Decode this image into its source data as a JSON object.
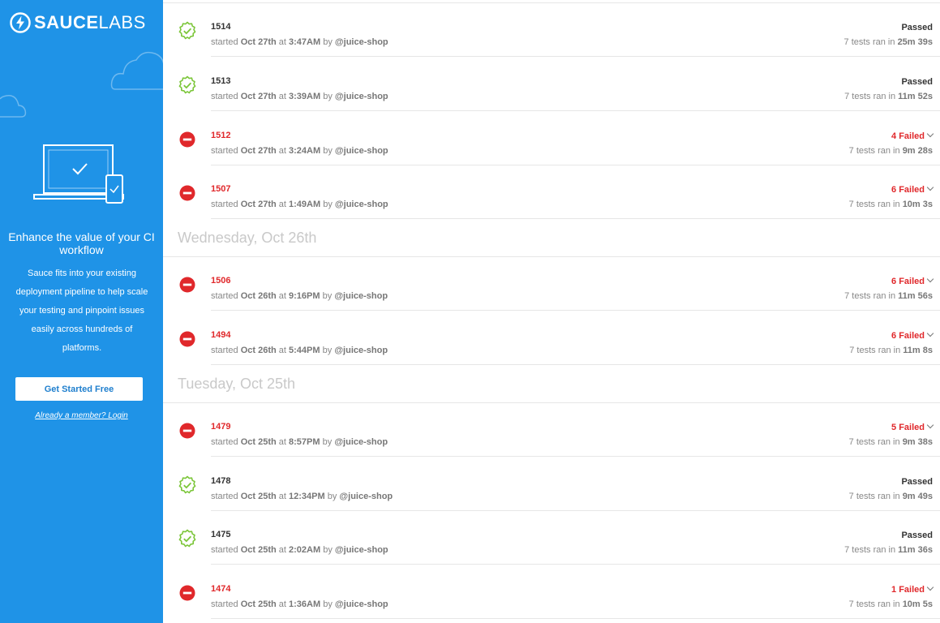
{
  "sidebar": {
    "logo_bold": "SAUCE",
    "logo_light": "LABS",
    "title": "Enhance the value of your CI workflow",
    "description": "Sauce fits into your existing deployment pipeline to help scale your testing and pinpoint issues easily across hundreds of platforms.",
    "cta_label": "Get Started Free",
    "login_label": "Already a member? Login"
  },
  "builds": [
    {
      "number": "1514",
      "status": "passed",
      "result": "Passed",
      "date": "Oct 27th",
      "time": "3:47AM",
      "user": "@juice-shop",
      "tests": "7",
      "duration": "25m 39s"
    },
    {
      "number": "1513",
      "status": "passed",
      "result": "Passed",
      "date": "Oct 27th",
      "time": "3:39AM",
      "user": "@juice-shop",
      "tests": "7",
      "duration": "11m 52s"
    },
    {
      "number": "1512",
      "status": "failed",
      "result": "4 Failed",
      "date": "Oct 27th",
      "time": "3:24AM",
      "user": "@juice-shop",
      "tests": "7",
      "duration": "9m 28s"
    },
    {
      "number": "1507",
      "status": "failed",
      "result": "6 Failed",
      "date": "Oct 27th",
      "time": "1:49AM",
      "user": "@juice-shop",
      "tests": "7",
      "duration": "10m 3s"
    },
    {
      "number": "1506",
      "status": "failed",
      "result": "6 Failed",
      "date": "Oct 26th",
      "time": "9:16PM",
      "user": "@juice-shop",
      "tests": "7",
      "duration": "11m 56s"
    },
    {
      "number": "1494",
      "status": "failed",
      "result": "6 Failed",
      "date": "Oct 26th",
      "time": "5:44PM",
      "user": "@juice-shop",
      "tests": "7",
      "duration": "11m 8s"
    },
    {
      "number": "1479",
      "status": "failed",
      "result": "5 Failed",
      "date": "Oct 25th",
      "time": "8:57PM",
      "user": "@juice-shop",
      "tests": "7",
      "duration": "9m 38s"
    },
    {
      "number": "1478",
      "status": "passed",
      "result": "Passed",
      "date": "Oct 25th",
      "time": "12:34PM",
      "user": "@juice-shop",
      "tests": "7",
      "duration": "9m 49s"
    },
    {
      "number": "1475",
      "status": "passed",
      "result": "Passed",
      "date": "Oct 25th",
      "time": "2:02AM",
      "user": "@juice-shop",
      "tests": "7",
      "duration": "11m 36s"
    },
    {
      "number": "1474",
      "status": "failed",
      "result": "1 Failed",
      "date": "Oct 25th",
      "time": "1:36AM",
      "user": "@juice-shop",
      "tests": "7",
      "duration": "10m 5s"
    }
  ],
  "date_headers": [
    "Wednesday, Oct 26th",
    "Tuesday, Oct 25th"
  ],
  "labels": {
    "started": "started",
    "at": "at",
    "by": "by",
    "tests_ran_in": "tests ran in"
  },
  "colors": {
    "sidebar": "#1f93e7",
    "passed": "#7cc63a",
    "failed": "#e0282b"
  }
}
